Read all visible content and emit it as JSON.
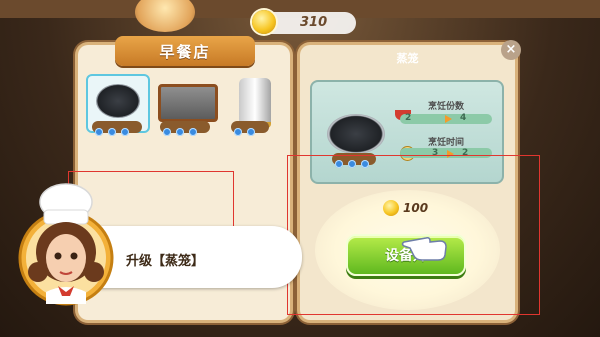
{
  "hud": {
    "coins": "310",
    "coin_icon": "coin-icon"
  },
  "left_panel": {
    "title": "早餐店",
    "items": [
      {
        "name": "griddle-pan",
        "selected": true,
        "level_dots": 3
      },
      {
        "name": "flat-grill",
        "selected": false,
        "level_dots": 3
      },
      {
        "name": "drink-urn",
        "selected": false,
        "level_dots": 2
      }
    ]
  },
  "right_panel": {
    "title": "蒸笼",
    "stats": {
      "portions_label": "烹饪份数",
      "portions_from": "2",
      "portions_to": "4",
      "time_label": "烹饪时间",
      "time_from": "3",
      "time_to": "2"
    },
    "cost": "100",
    "upgrade_button": "设备升"
  },
  "tutorial": {
    "message": "升级【蒸笼】"
  },
  "colors": {
    "accent_green": "#5fb81f",
    "ribbon_orange": "#e9a548",
    "highlight_red": "#e0362f",
    "coin_gold": "#f7c623"
  }
}
